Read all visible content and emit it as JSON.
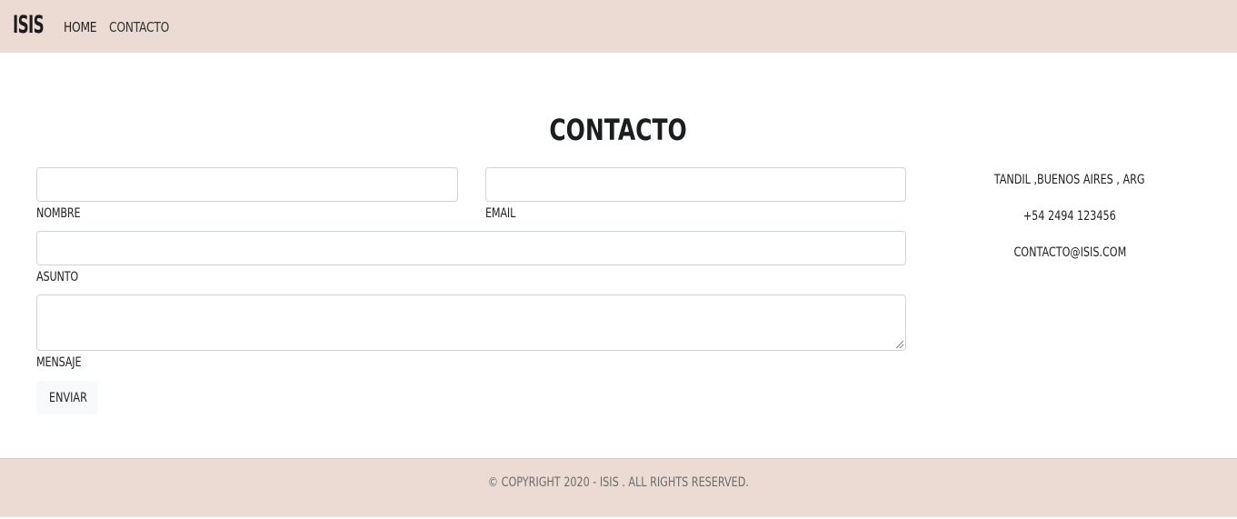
{
  "navbar": {
    "brand": "ISIS",
    "links": [
      {
        "label": "HOME"
      },
      {
        "label": "CONTACTO"
      }
    ]
  },
  "page": {
    "title": "CONTACTO"
  },
  "form": {
    "nombre": {
      "label": "NOMBRE",
      "value": "",
      "placeholder": ""
    },
    "email": {
      "label": "EMAIL",
      "value": "",
      "placeholder": ""
    },
    "asunto": {
      "label": "ASUNTO",
      "value": "",
      "placeholder": ""
    },
    "mensaje": {
      "label": "MENSAJE",
      "value": "",
      "placeholder": ""
    },
    "submit_label": "ENVIAR"
  },
  "contact_info": {
    "address": "TANDIL ,BUENOS AIRES , ARG",
    "phone": "+54 2494 123456",
    "email": "CONTACTO@ISIS.COM"
  },
  "footer": {
    "copyright": "© COPYRIGHT 2020 - ISIS . ALL RIGHTS RESERVED."
  },
  "colors": {
    "header_bg": "#ecdbd3",
    "footer_bg": "#ecdbd3",
    "button_bg": "#f8f9fa",
    "field_border": "#ced4da"
  }
}
